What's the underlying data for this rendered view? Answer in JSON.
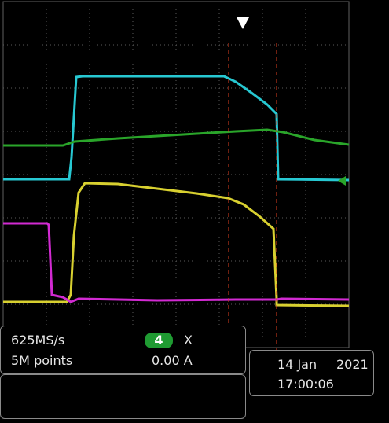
{
  "acquisition": {
    "sample_rate": "625MS/s",
    "record_length": "5M points"
  },
  "measurement": {
    "channel": "4",
    "label": "X",
    "value": "0.00 A"
  },
  "datetime": {
    "date": "14 Jan",
    "year": "2021",
    "time": "17:00:06"
  },
  "colors": {
    "ch_cyan": "#27c8d2",
    "ch_green": "#2aa52a",
    "ch_yellow": "#d8d030",
    "ch_magenta": "#d22ad2",
    "cursor": "#e04020",
    "grid": "#5a5a5a",
    "badge": "#1f9b32"
  },
  "trigger_marker_icon": "down-triangle-icon",
  "ground_marker_icon": "left-arrow-icon"
}
